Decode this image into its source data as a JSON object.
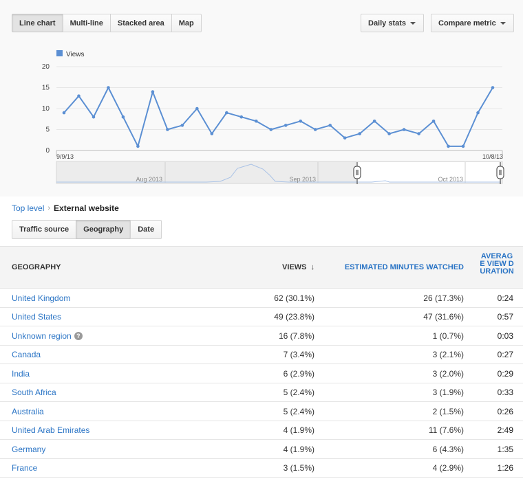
{
  "toolbar": {
    "tabs": [
      "Line chart",
      "Multi-line",
      "Stacked area",
      "Map"
    ],
    "active_tab": 0,
    "daily_stats": "Daily stats",
    "compare_metric": "Compare metric"
  },
  "chart_data": {
    "type": "line",
    "legend": "Views",
    "color": "#5b8fd3",
    "ylim": [
      0,
      20
    ],
    "yticks": [
      "0",
      "5",
      "10",
      "15",
      "20"
    ],
    "x_start_label": "9/9/13",
    "x_end_label": "10/8/13",
    "values": [
      9,
      13,
      8,
      15,
      8,
      1,
      14,
      5,
      6,
      10,
      4,
      9,
      8,
      7,
      5,
      6,
      7,
      5,
      6,
      3,
      4,
      7,
      4,
      5,
      4,
      7,
      1,
      1,
      9,
      15
    ]
  },
  "timeline": {
    "labels": [
      "Aug 2013",
      "Sep 2013",
      "Oct 2013"
    ]
  },
  "breadcrumb": {
    "root": "Top level",
    "separator": "›",
    "current": "External website"
  },
  "subtabs": {
    "items": [
      "Traffic source",
      "Geography",
      "Date"
    ],
    "active": 1
  },
  "table": {
    "headers": {
      "geography": "GEOGRAPHY",
      "views": "VIEWS",
      "minutes": "ESTIMATED MINUTES WATCHED",
      "duration": "AVERAGE VIEW DURATION"
    },
    "sort_indicator": "↓",
    "rows": [
      {
        "geo": "United Kingdom",
        "views": "62 (30.1%)",
        "minutes": "26 (17.3%)",
        "duration": "0:24"
      },
      {
        "geo": "United States",
        "views": "49 (23.8%)",
        "minutes": "47 (31.6%)",
        "duration": "0:57"
      },
      {
        "geo": "Unknown region",
        "views": "16 (7.8%)",
        "minutes": "1 (0.7%)",
        "duration": "0:03",
        "help": "?"
      },
      {
        "geo": "Canada",
        "views": "7 (3.4%)",
        "minutes": "3 (2.1%)",
        "duration": "0:27"
      },
      {
        "geo": "India",
        "views": "6 (2.9%)",
        "minutes": "3 (2.0%)",
        "duration": "0:29"
      },
      {
        "geo": "South Africa",
        "views": "5 (2.4%)",
        "minutes": "3 (1.9%)",
        "duration": "0:33"
      },
      {
        "geo": "Australia",
        "views": "5 (2.4%)",
        "minutes": "2 (1.5%)",
        "duration": "0:26"
      },
      {
        "geo": "United Arab Emirates",
        "views": "4 (1.9%)",
        "minutes": "11 (7.6%)",
        "duration": "2:49"
      },
      {
        "geo": "Germany",
        "views": "4 (1.9%)",
        "minutes": "6 (4.3%)",
        "duration": "1:35"
      },
      {
        "geo": "France",
        "views": "3 (1.5%)",
        "minutes": "4 (2.9%)",
        "duration": "1:26"
      }
    ]
  }
}
